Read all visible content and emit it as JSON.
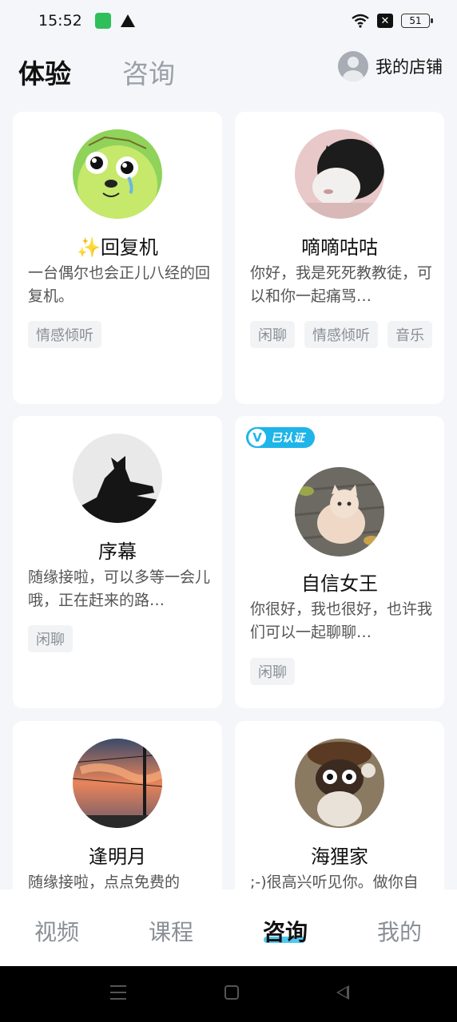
{
  "status_bar": {
    "time": "15:52",
    "battery": "51"
  },
  "header": {
    "tabs": [
      {
        "label": "体验",
        "active": true
      },
      {
        "label": "咨询",
        "active": false
      }
    ],
    "shop_label": "我的店铺"
  },
  "cards": [
    {
      "name": "✨回复机",
      "desc": "一台偶尔也会正儿八经的回复机。",
      "tags": [
        "情感倾听"
      ],
      "verified": false,
      "avatar": "yellow-cartoon-dog-avatar"
    },
    {
      "name": "嘀嘀咕咕",
      "desc": "你好，我是死死教教徒，可以和你一起痛骂…",
      "tags": [
        "闲聊",
        "情感倾听",
        "音乐"
      ],
      "verified": false,
      "avatar": "black-white-cat-avatar"
    },
    {
      "name": "序幕",
      "desc": "随缘接啦，可以多等一会儿哦，正在赶来的路…",
      "tags": [
        "闲聊"
      ],
      "verified": false,
      "avatar": "cat-silhouette-avatar"
    },
    {
      "name": "自信女王",
      "desc": "你很好，我也很好，也许我们可以一起聊聊…",
      "tags": [
        "闲聊"
      ],
      "verified": true,
      "verified_label": "已认证",
      "avatar": "cream-cat-avatar"
    },
    {
      "name": "逢明月",
      "desc": "随缘接啦，点点免费的",
      "tags": [],
      "verified": false,
      "avatar": "sunset-sky-avatar"
    },
    {
      "name": "海狸家",
      "desc": ";-)很高兴听见你。做你自",
      "tags": [],
      "verified": false,
      "avatar": "tanuki-figurine-avatar"
    }
  ],
  "bottom_nav": [
    {
      "label": "视频",
      "active": false
    },
    {
      "label": "课程",
      "active": false
    },
    {
      "label": "咨询",
      "active": true
    },
    {
      "label": "我的",
      "active": false
    }
  ],
  "colors": {
    "accent": "#27b8f0",
    "verified": "#1fb5e9",
    "background": "#f4f6f9"
  }
}
